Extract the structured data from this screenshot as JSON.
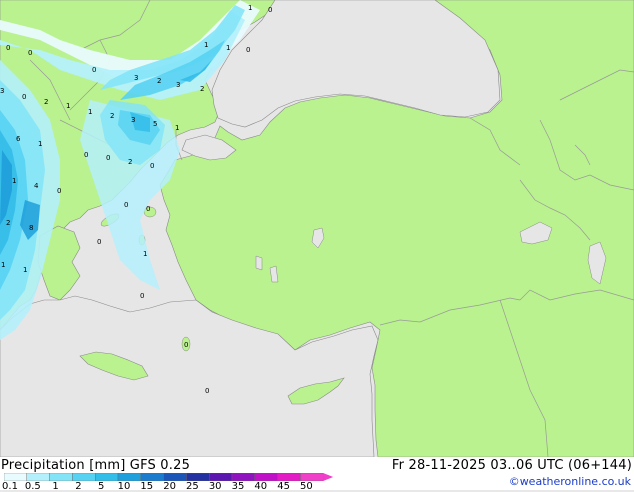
{
  "footer": {
    "title_left": "Precipitation [mm] GFS 0.25",
    "title_right": "Fr 28-11-2025 03..06 UTC (06+144)",
    "credit": "©weatheronline.co.uk"
  },
  "legend": {
    "values": [
      "0.1",
      "0.5",
      "1",
      "2",
      "5",
      "10",
      "15",
      "20",
      "25",
      "30",
      "35",
      "40",
      "45",
      "50"
    ],
    "colors": [
      "#e8fbfe",
      "#b4f0fb",
      "#84e4f7",
      "#58d2f2",
      "#33bde9",
      "#1f9fdb",
      "#1b7bcc",
      "#1c55b8",
      "#2431a1",
      "#5b17b0",
      "#8f13bf",
      "#c111c8",
      "#e31cc5",
      "#f03fc8"
    ]
  },
  "map": {
    "land_color": "#b9f28e",
    "sea_color": "#e6e6e6",
    "border_color": "#9a9a9a",
    "labels": [
      {
        "t": "1"
      },
      {
        "t": "0"
      },
      {
        "t": "1"
      },
      {
        "t": "1"
      },
      {
        "t": "0"
      },
      {
        "t": "0"
      },
      {
        "t": "0"
      },
      {
        "t": "0"
      },
      {
        "t": "3"
      },
      {
        "t": "2"
      },
      {
        "t": "3"
      },
      {
        "t": "2"
      },
      {
        "t": "3"
      },
      {
        "t": "0"
      },
      {
        "t": "2"
      },
      {
        "t": "1"
      },
      {
        "t": "1"
      },
      {
        "t": "2"
      },
      {
        "t": "3"
      },
      {
        "t": "5"
      },
      {
        "t": "1"
      },
      {
        "t": "6"
      },
      {
        "t": "1"
      },
      {
        "t": "0"
      },
      {
        "t": "0"
      },
      {
        "t": "2"
      },
      {
        "t": "0"
      },
      {
        "t": "1"
      },
      {
        "t": "4"
      },
      {
        "t": "0"
      },
      {
        "t": "0"
      },
      {
        "t": "0"
      },
      {
        "t": "2"
      },
      {
        "t": "8"
      },
      {
        "t": "0"
      },
      {
        "t": "1"
      },
      {
        "t": "1"
      },
      {
        "t": "1"
      },
      {
        "t": "0"
      },
      {
        "t": "0"
      },
      {
        "t": "0"
      }
    ]
  }
}
